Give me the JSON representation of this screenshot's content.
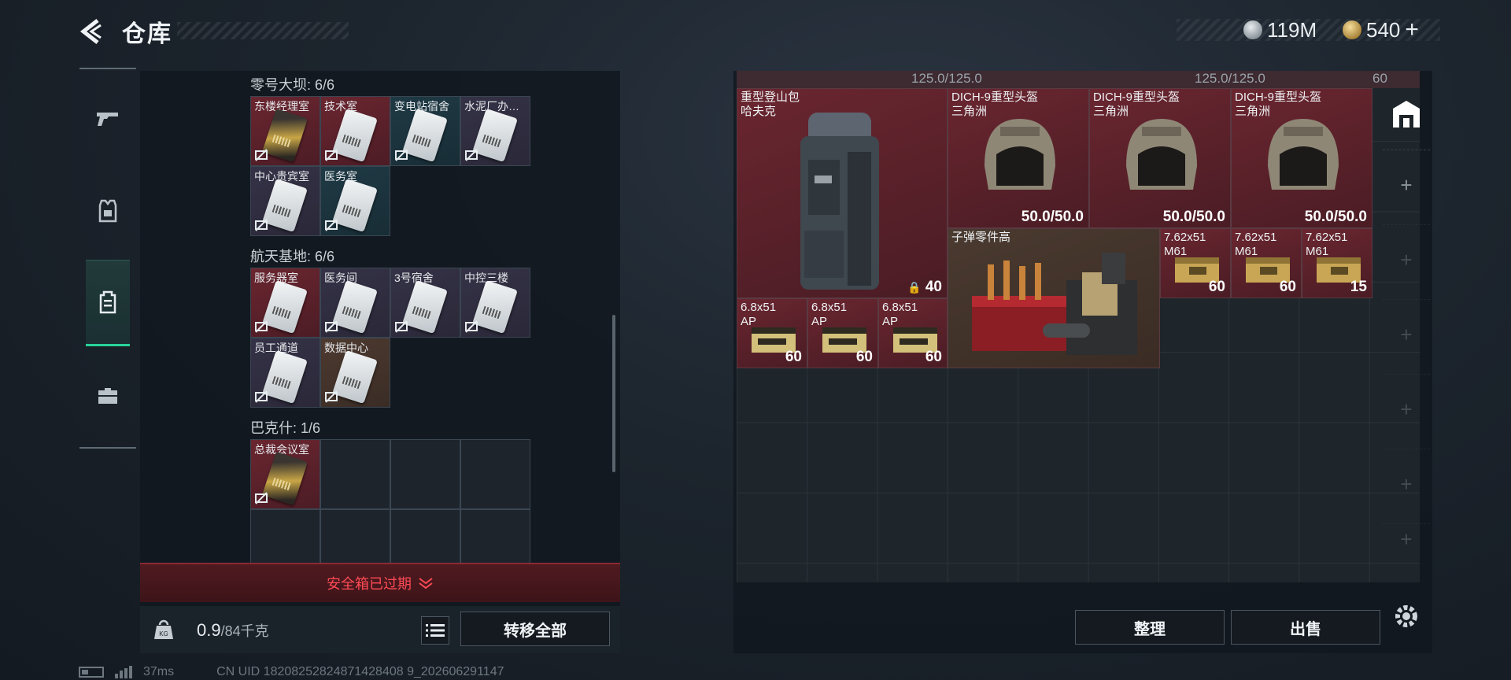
{
  "header": {
    "title": "仓库",
    "silver_amount": "119M",
    "gold_amount": "540",
    "plus_label": "+"
  },
  "left_nav": [
    "gun-icon",
    "armor-icon",
    "backpack-icon",
    "briefcase-icon"
  ],
  "key_sections": [
    {
      "title": "零号大坝: 6/6",
      "keys": [
        {
          "label": "东楼经理室",
          "color": "red",
          "card": "gold"
        },
        {
          "label": "技术室",
          "color": "red",
          "card": "white"
        },
        {
          "label": "变电站宿舍",
          "color": "teal",
          "card": "white"
        },
        {
          "label": "水泥厂办…",
          "color": "purple",
          "card": "white"
        },
        {
          "label": "中心贵宾室",
          "color": "purple",
          "card": "white"
        },
        {
          "label": "医务室",
          "color": "teal",
          "card": "white"
        }
      ]
    },
    {
      "title": "航天基地: 6/6",
      "keys": [
        {
          "label": "服务器室",
          "color": "red",
          "card": "white"
        },
        {
          "label": "医务间",
          "color": "purple",
          "card": "white"
        },
        {
          "label": "3号宿舍",
          "color": "purple",
          "card": "white"
        },
        {
          "label": "中控三楼",
          "color": "purple",
          "card": "white"
        },
        {
          "label": "员工通道",
          "color": "purple",
          "card": "white"
        },
        {
          "label": "数据中心",
          "color": "brown",
          "card": "white"
        }
      ]
    },
    {
      "title": "巴克什: 1/6",
      "keys": [
        {
          "label": "总裁会议室",
          "color": "red",
          "card": "gold"
        }
      ]
    }
  ],
  "safe_box": {
    "expired_label": "安全箱已过期"
  },
  "weight": {
    "current": "0.9",
    "max": "/84千克"
  },
  "transfer_all_label": "转移全部",
  "stash": {
    "top_strip": [
      "125.0/125.0",
      "125.0/125.0",
      "60"
    ],
    "backpack": {
      "name": "重型登山包\n哈夫克",
      "capacity": "40"
    },
    "helmets": [
      {
        "name": "DICH-9重型头盔\n三角洲",
        "durability": "50.0/50.0"
      },
      {
        "name": "DICH-9重型头盔\n三角洲",
        "durability": "50.0/50.0"
      },
      {
        "name": "DICH-9重型头盔\n三角洲",
        "durability": "50.0/50.0"
      }
    ],
    "parts": {
      "name": "子弹零件高"
    },
    "ammo_762": [
      {
        "name": "7.62x51\nM61",
        "count": "60"
      },
      {
        "name": "7.62x51\nM61",
        "count": "60"
      },
      {
        "name": "7.62x51\nM61",
        "count": "15"
      }
    ],
    "ammo_68": [
      {
        "name": "6.8x51\nAP",
        "count": "60"
      },
      {
        "name": "6.8x51\nAP",
        "count": "60"
      },
      {
        "name": "6.8x51\nAP",
        "count": "60"
      }
    ]
  },
  "actions": {
    "sort_label": "整理",
    "sell_label": "出售"
  },
  "status": {
    "ping": "37ms",
    "uid": "CN UID 18208252824871428408 9_202606291147"
  }
}
